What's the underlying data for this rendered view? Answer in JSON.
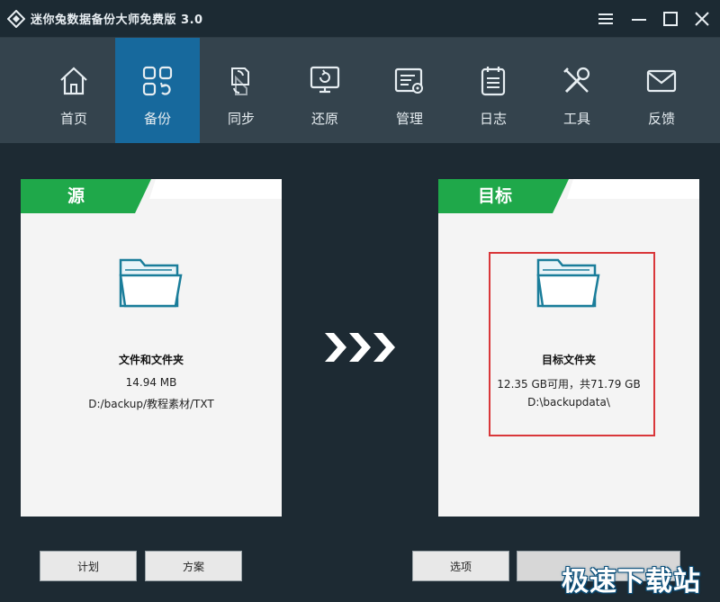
{
  "window": {
    "title": "迷你兔数据备份大师免费版 3.0",
    "controls": [
      {
        "name": "menu-icon"
      },
      {
        "name": "minimize-icon"
      },
      {
        "name": "maximize-icon"
      },
      {
        "name": "close-icon"
      }
    ]
  },
  "nav": {
    "items": [
      {
        "label": "首页",
        "icon": "home-icon"
      },
      {
        "label": "备份",
        "icon": "backup-icon",
        "active": true
      },
      {
        "label": "同步",
        "icon": "sync-icon"
      },
      {
        "label": "还原",
        "icon": "restore-icon"
      },
      {
        "label": "管理",
        "icon": "manage-icon"
      },
      {
        "label": "日志",
        "icon": "log-icon"
      },
      {
        "label": "工具",
        "icon": "tools-icon"
      },
      {
        "label": "反馈",
        "icon": "feedback-icon"
      }
    ]
  },
  "source": {
    "tab": "源",
    "title": "文件和文件夹",
    "size": "14.94 MB",
    "path": "D:/backup/教程素材/TXT"
  },
  "target": {
    "tab": "目标",
    "title": "目标文件夹",
    "space": "12.35 GB可用，共71.79 GB",
    "path": "D:\\backupdata\\"
  },
  "buttons": {
    "schedule": "计划",
    "scheme": "方案",
    "options": "选项",
    "backup_now": ""
  },
  "watermark": "极速下载站",
  "colors": {
    "accent_green": "#1fa84a",
    "nav_active": "#17699d",
    "highlight_red": "#d9373a"
  }
}
